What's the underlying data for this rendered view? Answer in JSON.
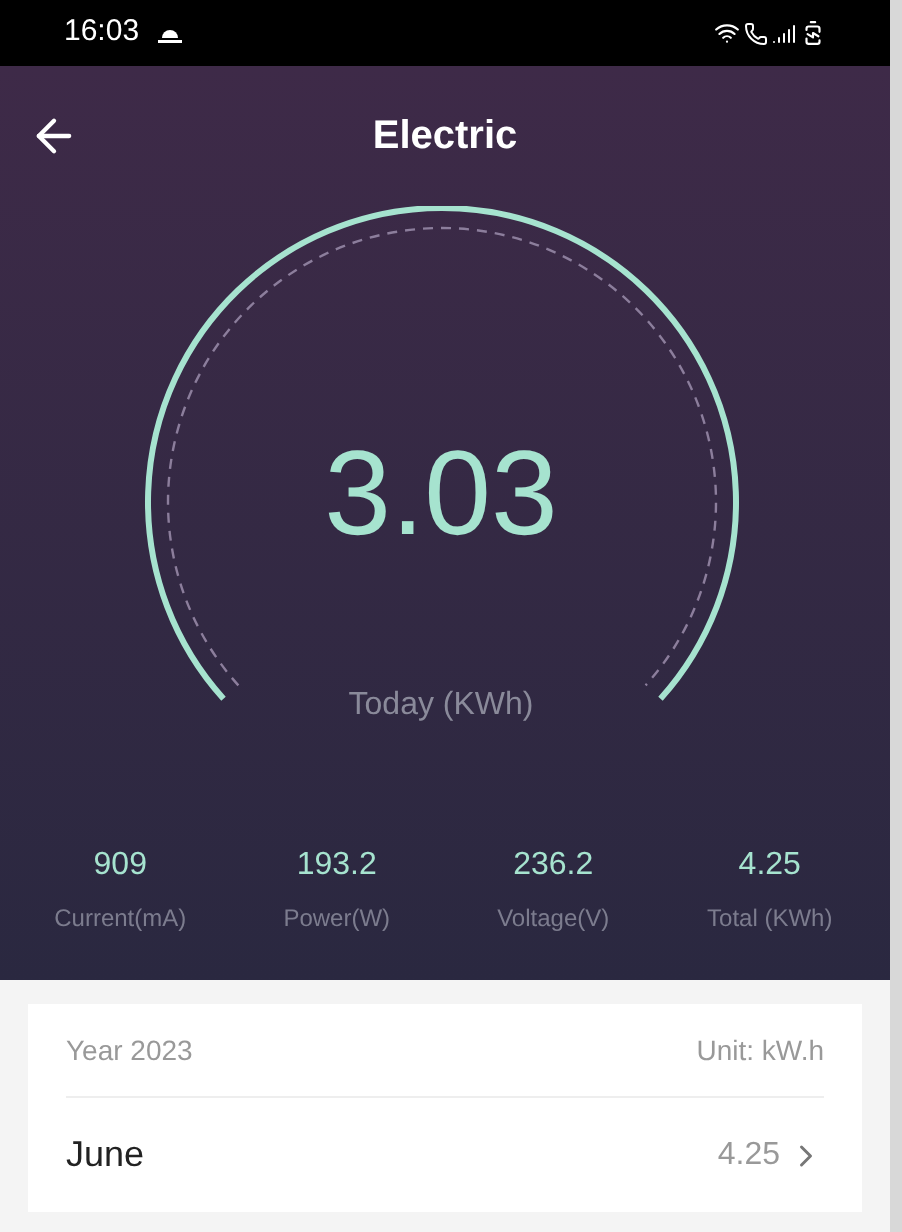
{
  "status_bar": {
    "time": "16:03"
  },
  "header": {
    "title": "Electric"
  },
  "gauge": {
    "value": "3.03",
    "caption": "Today (KWh)"
  },
  "stats": [
    {
      "value": "909",
      "label": "Current(mA)"
    },
    {
      "value": "193.2",
      "label": "Power(W)"
    },
    {
      "value": "236.2",
      "label": "Voltage(V)"
    },
    {
      "value": "4.25",
      "label": "Total (KWh)"
    }
  ],
  "history": {
    "year": "Year 2023",
    "unit": "Unit: kW.h",
    "rows": [
      {
        "month": "June",
        "value": "4.25"
      }
    ]
  }
}
